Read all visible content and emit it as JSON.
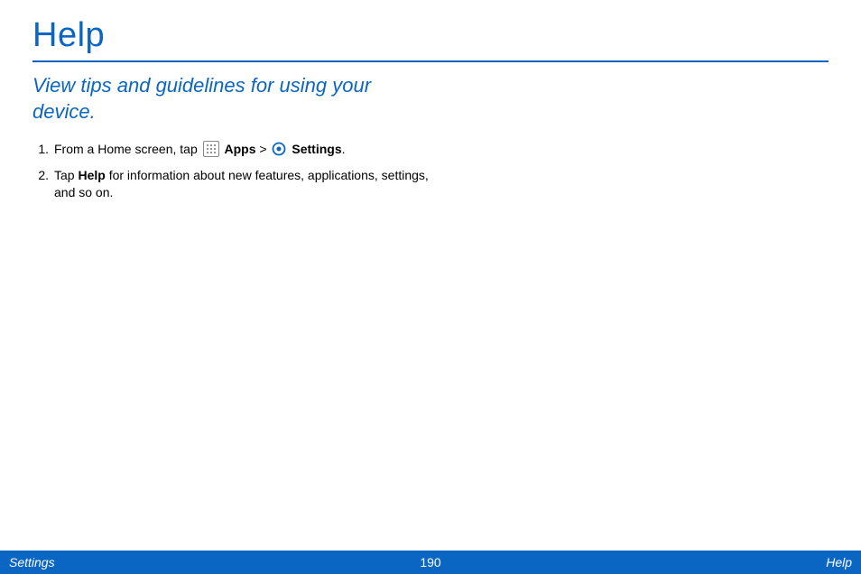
{
  "title": "Help",
  "subtitle": "View tips and guidelines for using your device.",
  "steps": {
    "1": {
      "num": "1.",
      "pre_text": "From a Home screen, tap ",
      "apps_label": "Apps",
      "separator": " > ",
      "settings_label": "Settings",
      "end": "."
    },
    "2": {
      "num": "2.",
      "pre_text": "Tap ",
      "bold_text": "Help",
      "post_text": " for information about new features, applications, settings, and so on."
    }
  },
  "footer": {
    "left": "Settings",
    "center": "190",
    "right": "Help"
  }
}
